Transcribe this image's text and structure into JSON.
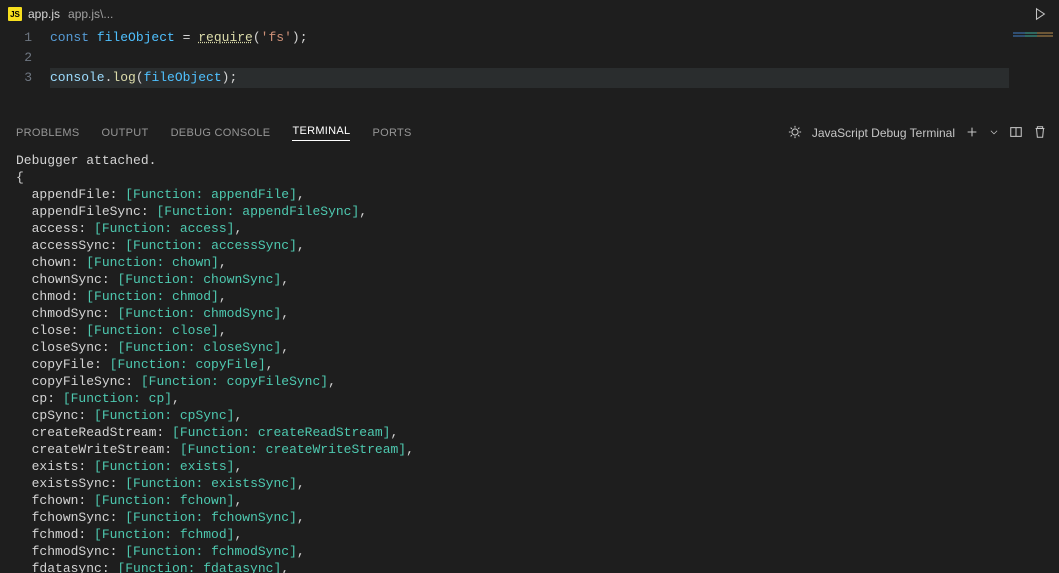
{
  "tab": {
    "icon": "JS",
    "filename": "app.js",
    "breadcrumb": "app.js\\..."
  },
  "editor": {
    "lines": {
      "1": "1",
      "2": "2",
      "3": "3"
    },
    "line1": {
      "const": "const",
      "var": "fileObject",
      "eq": " = ",
      "fn": "require",
      "open": "(",
      "str": "'fs'",
      "close": ")",
      "semi": ";"
    },
    "line3": {
      "console": "console",
      "dot": ".",
      "log": "log",
      "open": "(",
      "arg": "fileObject",
      "close": ")",
      "semi": ";"
    }
  },
  "panel": {
    "tabs": {
      "problems": "PROBLEMS",
      "output": "OUTPUT",
      "debug": "DEBUG CONSOLE",
      "terminal": "TERMINAL",
      "ports": "PORTS"
    },
    "terminalType": "JavaScript Debug Terminal"
  },
  "terminal": {
    "attached": "Debugger attached.",
    "brace": "{",
    "entries": [
      {
        "k": "appendFile",
        "v": "appendFile"
      },
      {
        "k": "appendFileSync",
        "v": "appendFileSync"
      },
      {
        "k": "access",
        "v": "access"
      },
      {
        "k": "accessSync",
        "v": "accessSync"
      },
      {
        "k": "chown",
        "v": "chown"
      },
      {
        "k": "chownSync",
        "v": "chownSync"
      },
      {
        "k": "chmod",
        "v": "chmod"
      },
      {
        "k": "chmodSync",
        "v": "chmodSync"
      },
      {
        "k": "close",
        "v": "close"
      },
      {
        "k": "closeSync",
        "v": "closeSync"
      },
      {
        "k": "copyFile",
        "v": "copyFile"
      },
      {
        "k": "copyFileSync",
        "v": "copyFileSync"
      },
      {
        "k": "cp",
        "v": "cp"
      },
      {
        "k": "cpSync",
        "v": "cpSync"
      },
      {
        "k": "createReadStream",
        "v": "createReadStream"
      },
      {
        "k": "createWriteStream",
        "v": "createWriteStream"
      },
      {
        "k": "exists",
        "v": "exists"
      },
      {
        "k": "existsSync",
        "v": "existsSync"
      },
      {
        "k": "fchown",
        "v": "fchown"
      },
      {
        "k": "fchownSync",
        "v": "fchownSync"
      },
      {
        "k": "fchmod",
        "v": "fchmod"
      },
      {
        "k": "fchmodSync",
        "v": "fchmodSync"
      },
      {
        "k": "fdatasync",
        "v": "fdatasync"
      }
    ]
  }
}
